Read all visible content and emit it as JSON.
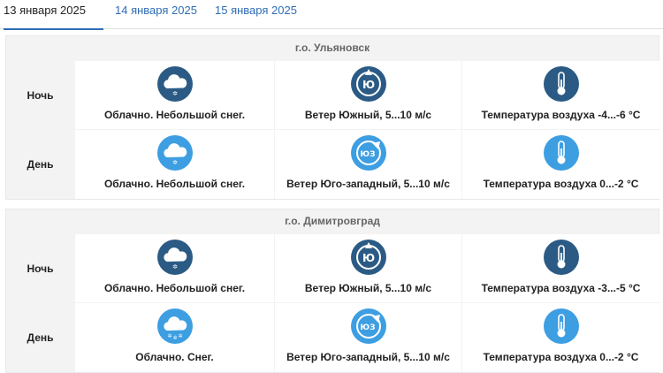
{
  "tabs": [
    {
      "label": "13 января 2025"
    },
    {
      "label": "14 января 2025"
    },
    {
      "label": "15 января 2025"
    }
  ],
  "colors": {
    "night": "#2b5b85",
    "day": "#3d9ee2",
    "tab_accent": "#2f6db5"
  },
  "blocks": [
    {
      "city": "г.о. Ульяновск",
      "rows": [
        {
          "period": "Ночь",
          "cells": [
            {
              "icon": "cloud-snow-icon",
              "text": "Облачно. Небольшой снег."
            },
            {
              "icon": "wind-south-icon",
              "text": "Ветер Южный, 5...10 м/с"
            },
            {
              "icon": "thermometer-icon",
              "text": "Температура воздуха -4...-6 °C"
            }
          ]
        },
        {
          "period": "День",
          "cells": [
            {
              "icon": "cloud-snow-icon",
              "text": "Облачно. Небольшой снег."
            },
            {
              "icon": "wind-southwest-icon",
              "text": "Ветер Юго-западный, 5...10 м/с"
            },
            {
              "icon": "thermometer-icon",
              "text": "Температура воздуха 0...-2 °C"
            }
          ]
        }
      ]
    },
    {
      "city": "г.о. Димитровград",
      "rows": [
        {
          "period": "Ночь",
          "cells": [
            {
              "icon": "cloud-snow-icon",
              "text": "Облачно. Небольшой снег."
            },
            {
              "icon": "wind-south-icon",
              "text": "Ветер Южный, 5...10 м/с"
            },
            {
              "icon": "thermometer-icon",
              "text": "Температура воздуха -3...-5 °C"
            }
          ]
        },
        {
          "period": "День",
          "cells": [
            {
              "icon": "cloud-heavy-snow-icon",
              "text": "Облачно. Снег."
            },
            {
              "icon": "wind-southwest-icon",
              "text": "Ветер Юго-западный, 5...10 м/с"
            },
            {
              "icon": "thermometer-icon",
              "text": "Температура воздуха 0...-2 °C"
            }
          ]
        }
      ]
    }
  ]
}
